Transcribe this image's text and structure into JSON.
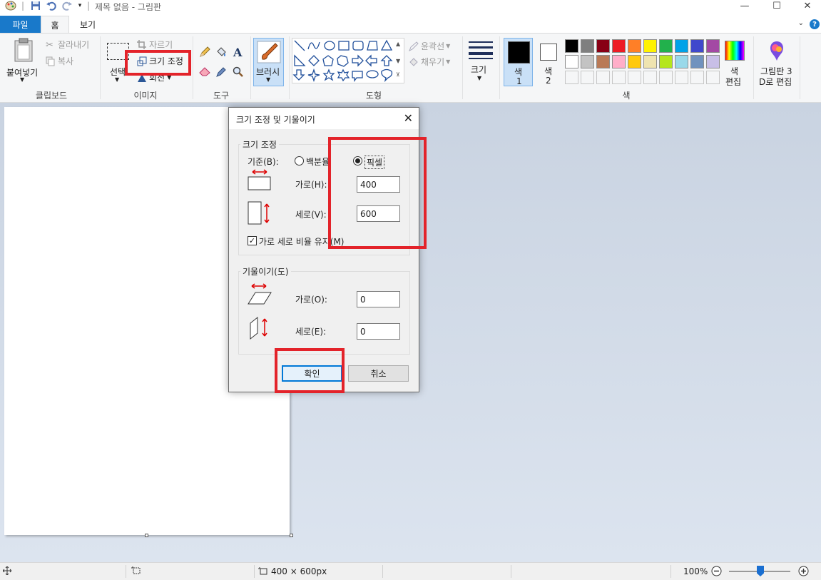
{
  "window": {
    "title": "제목 없음 - 그림판"
  },
  "tabs": {
    "file": "파일",
    "home": "홈",
    "view": "보기"
  },
  "ribbon": {
    "clipboard": {
      "paste": "붙여넣기",
      "cut": "잘라내기",
      "copy": "복사",
      "group_label": "클립보드"
    },
    "image": {
      "select": "선택",
      "crop": "자르기",
      "resize": "크기 조정",
      "rotate": "회전",
      "group_label": "이미지"
    },
    "tools": {
      "group_label": "도구"
    },
    "brushes": {
      "label": "브러시"
    },
    "shapes": {
      "outline": "윤곽선",
      "fill": "채우기",
      "group_label": "도형"
    },
    "size": {
      "label": "크기"
    },
    "colors": {
      "color1_line1": "색",
      "color1_line2": "1",
      "color2_line1": "색",
      "color2_line2": "2",
      "edit_line1": "색",
      "edit_line2": "편집",
      "group_label": "색",
      "color1_value": "#000000",
      "color2_value": "#ffffff",
      "palette_row1": [
        "#000000",
        "#7f7f7f",
        "#880015",
        "#ed1c24",
        "#ff7f27",
        "#fff200",
        "#22b14c",
        "#00a2e8",
        "#3f48cc",
        "#a349a4"
      ],
      "palette_row2": [
        "#ffffff",
        "#c3c3c3",
        "#b97a57",
        "#ffaec9",
        "#ffc90e",
        "#efe4b0",
        "#b5e61d",
        "#99d9ea",
        "#7092be",
        "#c8bfe7"
      ]
    },
    "paint3d": {
      "line1": "그림판 3",
      "line2": "D로 편집"
    }
  },
  "dialog": {
    "title": "크기 조정 및 기울이기",
    "resize_section": "크기 조정",
    "by_label": "기준(B):",
    "percent_label": "백분율",
    "pixels_label": "픽셀",
    "horizontal_label": "가로(H):",
    "vertical_label": "세로(V):",
    "horizontal_value": "400",
    "vertical_value": "600",
    "maintain_ratio_label": "가로 세로 비율 유지(M)",
    "maintain_ratio_checked": true,
    "selected_unit": "pixels",
    "skew_section": "기울이기(도)",
    "skew_horizontal_label": "가로(O):",
    "skew_vertical_label": "세로(E):",
    "skew_horizontal_value": "0",
    "skew_vertical_value": "0",
    "ok_label": "확인",
    "cancel_label": "취소"
  },
  "statusbar": {
    "image_size": "400 × 600px",
    "zoom": "100%"
  }
}
